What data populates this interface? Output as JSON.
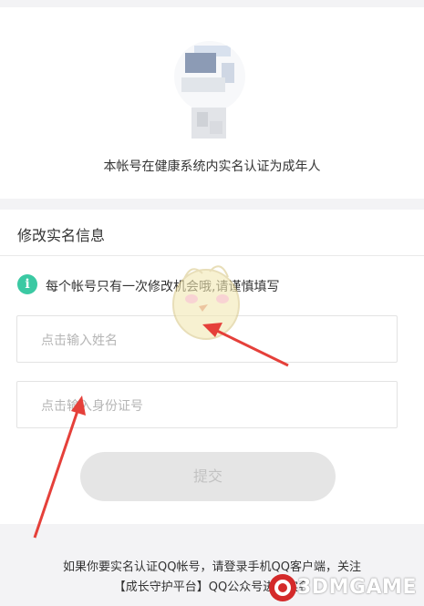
{
  "verification": {
    "status_text": "本帐号在健康系统内实名认证为成年人"
  },
  "form": {
    "section_title": "修改实名信息",
    "tip_icon": "info-icon",
    "tip_icon_glyph": "i",
    "tip_text": "每个帐号只有一次修改机会哦,请谨慎填写",
    "name_placeholder": "点击输入姓名",
    "id_placeholder": "点击输入身份证号",
    "submit_label": "提交"
  },
  "footer": {
    "line1": "如果你要实名认证QQ帐号，请登录手机QQ客户端，关注",
    "line2": "【成长守护平台】QQ公众号进行实名"
  },
  "watermark": {
    "text": "3DMGAME"
  },
  "colors": {
    "accent_green": "#3bc9a3",
    "arrow_red": "#e5403a",
    "submit_disabled_bg": "#e5e5e5"
  }
}
